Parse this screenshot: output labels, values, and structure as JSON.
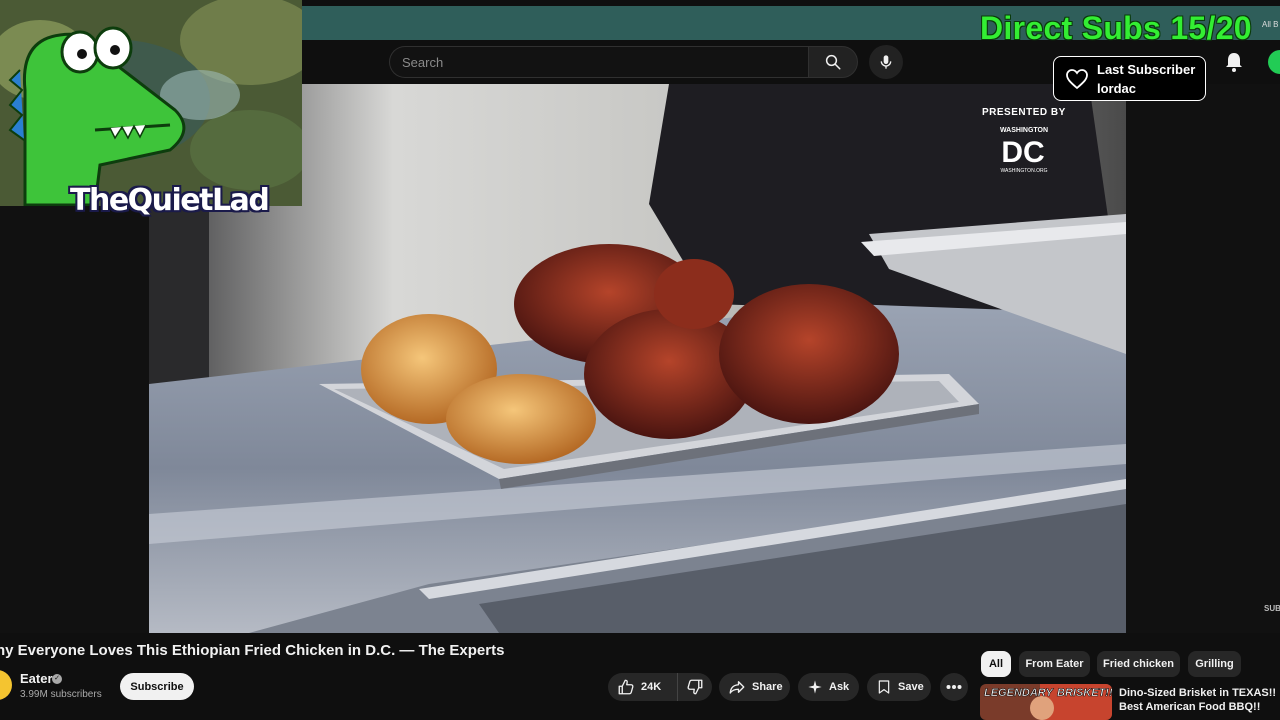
{
  "overlay": {
    "subs_goal": "Direct Subs 15/20",
    "corner_text": "All B",
    "last_subscriber_label": "Last Subscriber",
    "last_subscriber_name": "lordac",
    "streamer_name": "TheQuietLad"
  },
  "masthead": {
    "search_placeholder": "Search",
    "icons": [
      "search-icon",
      "microphone-icon",
      "bell-icon"
    ]
  },
  "video": {
    "presented_by": "PRESENTED BY",
    "sponsor_small": "WASHINGTON",
    "sponsor_logo": "DC",
    "sponsor_url": "WASHINGTON.ORG",
    "corner_mark": "SUB",
    "title": "hy Everyone Loves This Ethiopian Fried Chicken in D.C. — The Experts"
  },
  "channel": {
    "name": "Eater",
    "subscribers": "3.99M subscribers",
    "subscribe_label": "Subscribe"
  },
  "actions": {
    "like_count": "24K",
    "share_label": "Share",
    "ask_label": "Ask",
    "save_label": "Save"
  },
  "chips": [
    "All",
    "From Eater",
    "Fried chicken",
    "Grilling"
  ],
  "recommendation": {
    "thumb_text_1": "LEGENDARY",
    "thumb_text_2": "BRISKET!!!",
    "title": "Dino-Sized Brisket in TEXAS!! Best American Food BBQ!!"
  },
  "colors": {
    "background": "#0f0f0f",
    "teal_bar": "#2f5e5a",
    "goal_green": "#33ee33",
    "pill": "#272727"
  }
}
